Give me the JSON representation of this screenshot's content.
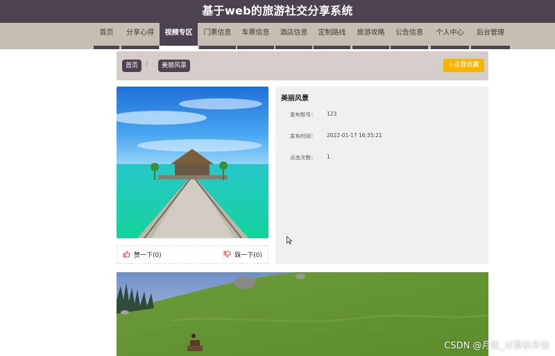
{
  "header": {
    "site_title": "基于web的旅游社交分享系统"
  },
  "nav": {
    "items": [
      {
        "label": "首页"
      },
      {
        "label": "分享心得"
      },
      {
        "label": "视频专区"
      },
      {
        "label": "门票信息"
      },
      {
        "label": "车票信息"
      },
      {
        "label": "酒店信息"
      },
      {
        "label": "定制路线"
      },
      {
        "label": "旅游攻略"
      },
      {
        "label": "公告信息"
      },
      {
        "label": "个人中心"
      },
      {
        "label": "后台管理"
      }
    ],
    "active_index": 2
  },
  "breadcrumb": {
    "home": "首页",
    "separator": "/",
    "current": "美丽风景"
  },
  "actions": {
    "favorite": "☆点我收藏"
  },
  "detail": {
    "title": "美丽风景",
    "fields": [
      {
        "label": "发布账号：",
        "value": "123"
      },
      {
        "label": "发布时间：",
        "value": "2022-01-17 16:35:21"
      },
      {
        "label": "点击次数：",
        "value": "1"
      }
    ]
  },
  "reactions": {
    "like": "赞一下(0)",
    "dislike": "踩一下(0)"
  },
  "watermark": "CSDN @月影_计算机毕设",
  "colors": {
    "header_bg": "#4d4250",
    "nav_bg": "#c8bdb3",
    "accent": "#f6b400",
    "like_red": "#e04a4a"
  }
}
